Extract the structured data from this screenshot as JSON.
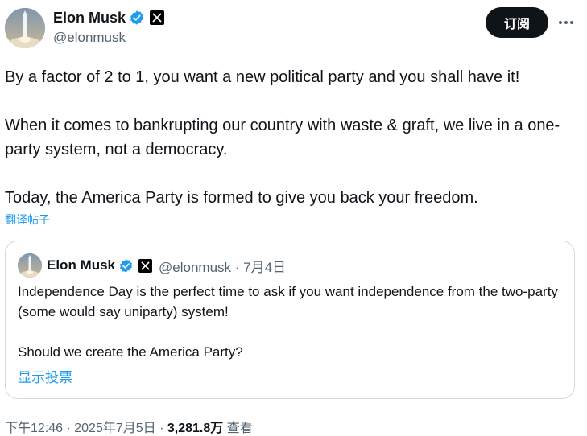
{
  "header": {
    "display_name": "Elon Musk",
    "handle": "@elonmusk",
    "subscribe_label": "订阅",
    "avatar_icon": "rocket-launch-avatar",
    "verified_icon": "verified-badge-icon",
    "affiliation_icon": "x-logo-icon",
    "more_icon": "more-dots-icon"
  },
  "tweet": {
    "paragraphs": [
      "By a factor of 2 to 1, you want a new political party and you shall have it!",
      "When it comes to bankrupting our country with waste & graft, we live in a one-party system, not a democracy.",
      "Today, the America Party is formed to give you back your freedom."
    ],
    "translate_label": "翻译帖子"
  },
  "quote": {
    "display_name": "Elon Musk",
    "handle_date": "@elonmusk · 7月4日",
    "paragraphs": [
      "Independence Day is the perfect time to ask if you want independence from the two-party (some would say uniparty) system!",
      "Should we create the America Party?"
    ],
    "poll_label": "显示投票"
  },
  "meta": {
    "timestamp": "下午12:46 · 2025年7月5日 · ",
    "views_count": "3,281.8万",
    "views_label": " 查看"
  },
  "colors": {
    "accent": "#1d9bf0",
    "text": "#0f1419",
    "muted": "#536471",
    "border": "#cfd9de",
    "button_bg": "#0f1419"
  }
}
